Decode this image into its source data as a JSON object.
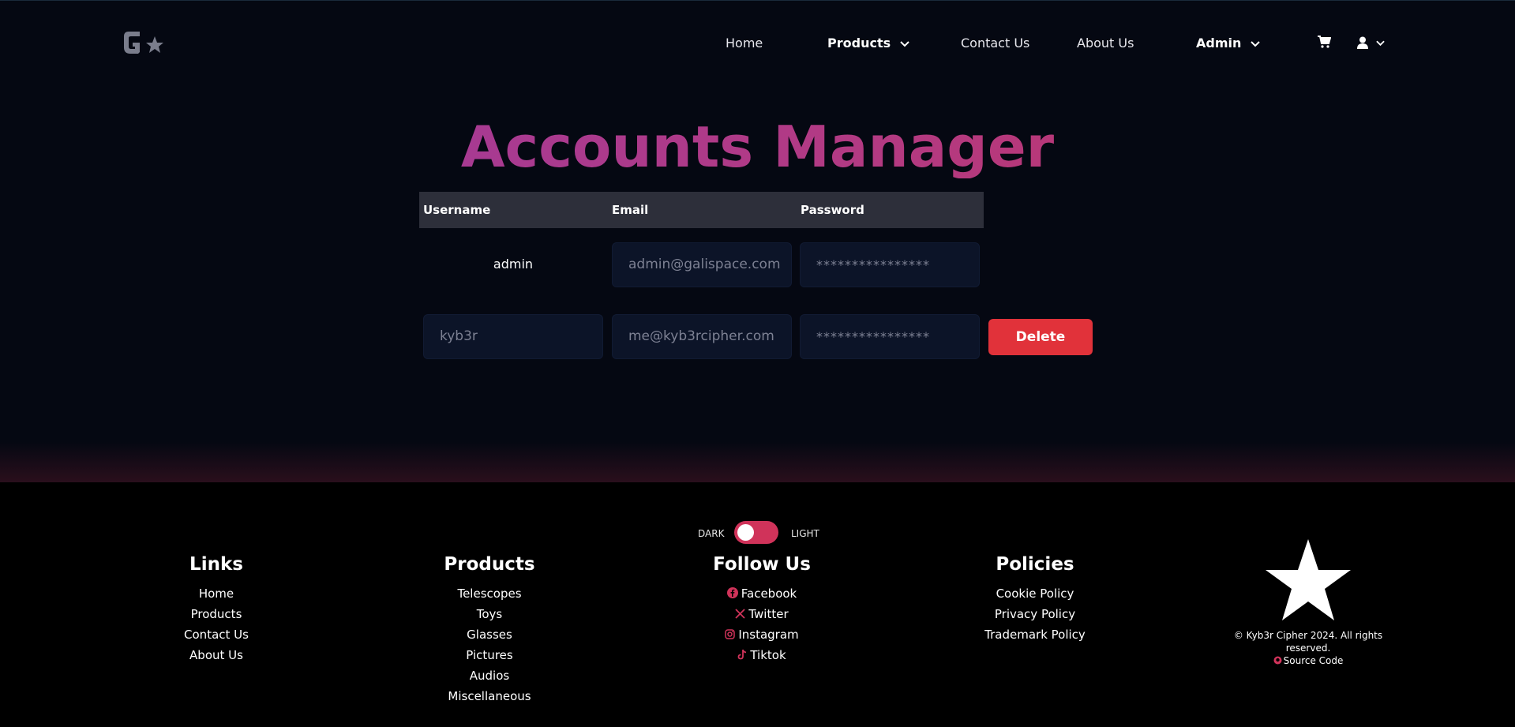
{
  "nav": {
    "home": "Home",
    "products": "Products",
    "contact": "Contact Us",
    "about": "About Us",
    "admin": "Admin"
  },
  "main": {
    "title": "Accounts Manager",
    "columns": {
      "username": "Username",
      "email": "Email",
      "password": "Password"
    },
    "rows": [
      {
        "username": "admin",
        "email": "admin@galispace.com",
        "password": "****************"
      },
      {
        "username": "kyb3r",
        "email": "me@kyb3rcipher.com",
        "password": "****************",
        "action": "Delete"
      }
    ]
  },
  "footer": {
    "theme": {
      "dark": "DARK",
      "light": "LIGHT"
    },
    "links": {
      "title": "Links",
      "items": [
        "Home",
        "Products",
        "Contact Us",
        "About Us"
      ]
    },
    "products": {
      "title": "Products",
      "items": [
        "Telescopes",
        "Toys",
        "Glasses",
        "Pictures",
        "Audios",
        "Miscellaneous"
      ]
    },
    "follow": {
      "title": "Follow Us",
      "items": [
        "Facebook",
        "Twitter",
        "Instagram",
        "Tiktok"
      ]
    },
    "policies": {
      "title": "Policies",
      "items": [
        "Cookie Policy",
        "Privacy Policy",
        "Trademark Policy"
      ]
    },
    "copyright": "© Kyb3r Cipher 2024. All rights reserved.",
    "source": "Source Code"
  },
  "colors": {
    "accent": "#d0335a",
    "delete": "#e1323a",
    "background": "#050812"
  }
}
